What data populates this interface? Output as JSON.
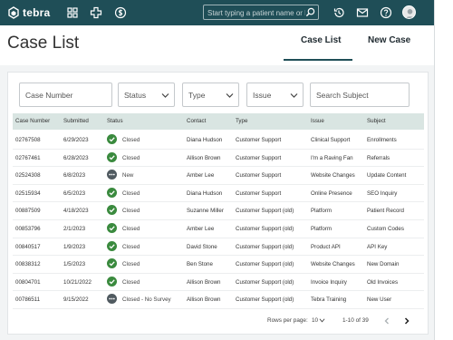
{
  "topbar": {
    "logo_text": "tebra",
    "search_placeholder": "Start typing a patient name or DOB",
    "icons": [
      "apps-icon",
      "add-icon",
      "billing-icon",
      "history-icon",
      "mail-icon",
      "help-icon",
      "user-avatar"
    ]
  },
  "header": {
    "title": "Case List",
    "tabs": [
      {
        "label": "Case List",
        "active": true
      },
      {
        "label": "New Case",
        "active": false
      }
    ]
  },
  "filters": {
    "case_number": "Case Number",
    "status": "Status",
    "type": "Type",
    "issue": "Issue",
    "search_subject": "Search Subject"
  },
  "table": {
    "columns": [
      "Case Number",
      "Submitted",
      "Status",
      "Contact",
      "Type",
      "Issue",
      "Subject"
    ],
    "rows": [
      {
        "case": "02767508",
        "submitted": "6/29/2023",
        "status": "Closed",
        "status_kind": "ok",
        "contact": "Diana Hudson",
        "type": "Customer Support",
        "issue": "Clinical Support",
        "subject": "Enrollments"
      },
      {
        "case": "02767461",
        "submitted": "6/28/2023",
        "status": "Closed",
        "status_kind": "ok",
        "contact": "Allison Brown",
        "type": "Customer Support",
        "issue": "I'm a Raving Fan",
        "subject": "Referrals"
      },
      {
        "case": "02524308",
        "submitted": "6/8/2023",
        "status": "New",
        "status_kind": "pending",
        "contact": "Amber Lee",
        "type": "Customer Support",
        "issue": "Website Changes",
        "subject": "Update Content"
      },
      {
        "case": "02515934",
        "submitted": "6/5/2023",
        "status": "Closed",
        "status_kind": "ok",
        "contact": "Diana Hudson",
        "type": "Customer Support",
        "issue": "Online Presence",
        "subject": "SEO Inquiry"
      },
      {
        "case": "00887509",
        "submitted": "4/18/2023",
        "status": "Closed",
        "status_kind": "ok",
        "contact": "Suzanne Miller",
        "type": "Customer Support (old)",
        "issue": "Platform",
        "subject": "Patient Record"
      },
      {
        "case": "00853796",
        "submitted": "2/1/2023",
        "status": "Closed",
        "status_kind": "ok",
        "contact": "Amber Lee",
        "type": "Customer Support (old)",
        "issue": "Platform",
        "subject": "Custom Codes"
      },
      {
        "case": "00840517",
        "submitted": "1/9/2023",
        "status": "Closed",
        "status_kind": "ok",
        "contact": "David Stone",
        "type": "Customer Support (old)",
        "issue": "Product API",
        "subject": "API Key"
      },
      {
        "case": "00838312",
        "submitted": "1/5/2023",
        "status": "Closed",
        "status_kind": "ok",
        "contact": "Ben Stone",
        "type": "Customer Support (old)",
        "issue": "Website Changes",
        "subject": "New Domain"
      },
      {
        "case": "00804701",
        "submitted": "10/21/2022",
        "status": "Closed",
        "status_kind": "ok",
        "contact": "Allison Brown",
        "type": "Customer Support (old)",
        "issue": "Invoice Inquiry",
        "subject": "Old Invoices"
      },
      {
        "case": "00786511",
        "submitted": "9/15/2022",
        "status": "Closed - No Survey",
        "status_kind": "pending",
        "contact": "Allison Brown",
        "type": "Customer Support (old)",
        "issue": "Tebra Training",
        "subject": "New User"
      }
    ]
  },
  "pagination": {
    "rows_per_page_label": "Rows per page:",
    "rows_per_page": "10",
    "range": "1-10 of 39"
  },
  "colors": {
    "topbar": "#1f4e57",
    "header_row": "#d9e5e2",
    "status_ok": "#3a8a3e",
    "status_pending": "#505a60"
  }
}
